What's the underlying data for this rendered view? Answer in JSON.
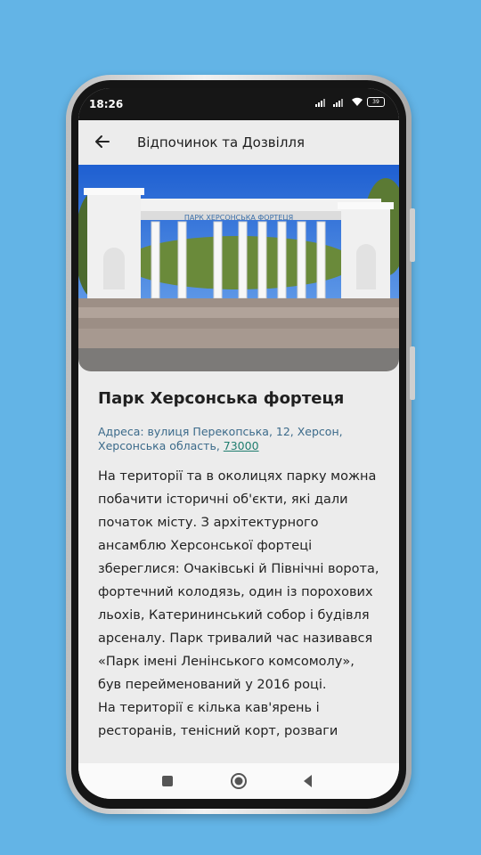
{
  "status_bar": {
    "time": "18:26",
    "battery_level": "39",
    "icons": [
      "signal-icon",
      "signal-icon",
      "wifi-icon",
      "battery-icon"
    ]
  },
  "app_bar": {
    "back_icon": "arrow-left-icon",
    "title": "Відпочинок та Дозвілля"
  },
  "place": {
    "title": "Парк Херсонська фортеця",
    "gate_sign": "ПАРК ХЕРСОНСЬКА ФОРТЕЦЯ",
    "address_prefix": "Адреса: вулиця Перекопська, 12, Херсон, Херсонська область, ",
    "postal_code": "73000",
    "description": [
      "На території та в околицях парку можна побачити історичні об'єкти, які дали початок місту. З архітектурного ансамблю Херсонської фортеці збереглися: Очаківські й Північні ворота, фортечний колодязь, один із порохових льохів, Катерининський собор і будівля арсеналу. Парк тривалий час називався «Парк імені Ленінського комсомолу», був перейменований у 2016 році.",
      "На території є кілька кав'ярень і ресторанів, тенісний корт, розваги"
    ]
  },
  "nav_bar": {
    "icons": [
      "square-recents-icon",
      "circle-home-icon",
      "triangle-back-icon"
    ]
  },
  "colors": {
    "background": "#63b4e6",
    "screen": "#ececec",
    "address_text": "#3b6a8a",
    "link": "#1f7d6f"
  }
}
